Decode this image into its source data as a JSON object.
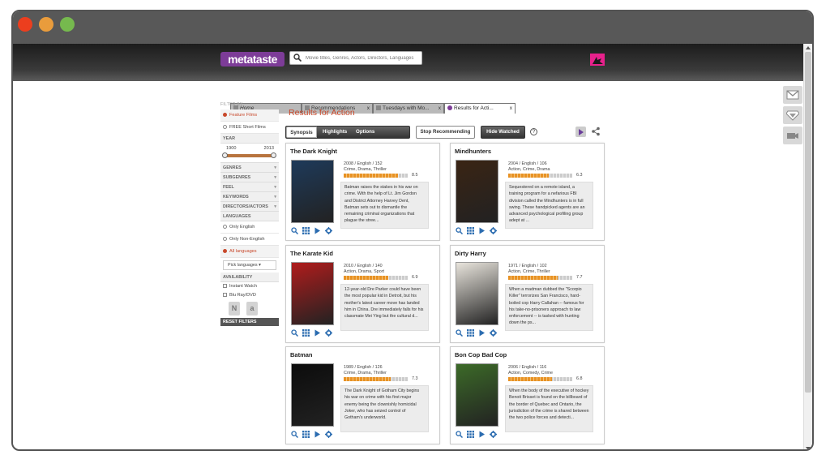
{
  "window_controls": [
    "close",
    "minimize",
    "maximize"
  ],
  "header": {
    "logo": "metataste",
    "search_placeholder": "Movie titles, Genres, Actors, Directors, Languages"
  },
  "tabs": [
    {
      "label": "Home",
      "close": ""
    },
    {
      "label": "Recommendations",
      "close": "x"
    },
    {
      "label": "Tuesdays with Mo...",
      "close": "x"
    },
    {
      "label": "Results for Acti...",
      "close": "x"
    }
  ],
  "sidebar": {
    "filter_by": "FILTER BY",
    "film_types": [
      {
        "label": "Feature Films",
        "selected": true
      },
      {
        "label": "FREE Short Films",
        "selected": false
      }
    ],
    "year": {
      "label": "YEAR",
      "from": "1900",
      "to": "2013"
    },
    "sections": [
      "GENRES",
      "SUBGENRES",
      "FEEL",
      "KEYWORDS",
      "DIRECTORS/ACTORS"
    ],
    "languages": {
      "label": "LANGUAGES",
      "options": [
        {
          "label": "Only English",
          "selected": false
        },
        {
          "label": "Only Non-English",
          "selected": false
        },
        {
          "label": "All languages",
          "selected": true
        }
      ],
      "pick": "Pick languages"
    },
    "availability": {
      "label": "AVAILABILITY",
      "options": [
        "Instant Watch",
        "Blu Ray/DVD"
      ],
      "logos": [
        "N",
        "a"
      ]
    },
    "reset": "RESET FILTERS"
  },
  "main": {
    "title": "Results for Action",
    "segments": [
      "Synopsis",
      "Highlights",
      "Options"
    ],
    "stop_recommending": "Stop Recommending",
    "hide_watched": "Hide Watched",
    "help": "?"
  },
  "movies": [
    {
      "title": "The Dark Knight",
      "meta": "2008 / English / 152",
      "genres": "Crime, Drama, Thriller",
      "rating": "8.5",
      "rating_value": 8.5,
      "synopsis": "Batman raises the stakes in his war on crime. With the help of Lt. Jim Gordon and District Attorney Harvey Dent, Batman sets out to dismantle the remaining criminal organizations that plague the stree...",
      "poster_color": "#1e3a5a"
    },
    {
      "title": "Mindhunters",
      "meta": "2004 / English / 106",
      "genres": "Action, Crime, Drama",
      "rating": "6.3",
      "rating_value": 6.3,
      "synopsis": "Sequestered on a remote island, a training program for a nefarious FBI division called the Mindhunters is in full swing. These handpicked agents are an advanced psychological profiling group adept at ...",
      "poster_color": "#3a2414"
    },
    {
      "title": "The Karate Kid",
      "meta": "2010 / English / 140",
      "genres": "Action, Drama, Sport",
      "rating": "6.9",
      "rating_value": 6.9,
      "synopsis": "12-year-old Dre Parker could have been the most popular kid in Detroit, but his mother's latest career move has landed him in China. Dre immediately falls for his classmate Mei Ying but the cultural d...",
      "poster_color": "#b01c1c"
    },
    {
      "title": "Dirty Harry",
      "meta": "1971 / English / 102",
      "genres": "Action, Crime, Thriller",
      "rating": "7.7",
      "rating_value": 7.7,
      "synopsis": "When a madman dubbed the \"Scorpio Killer\" terrorizes San Francisco, hard-boiled cop Harry Callahan -- famous for his take-no-prisoners approach to law enforcement -- is tasked with hunting down the ps...",
      "poster_color": "#e8e4dc"
    },
    {
      "title": "Batman",
      "meta": "1989 / English / 126",
      "genres": "Crime, Drama, Thriller",
      "rating": "7.3",
      "rating_value": 7.3,
      "synopsis": "The Dark Knight of Gotham City begins his war on crime with his first major enemy being the clownishly homicidal Joker, who has seized control of Gotham's underworld.",
      "poster_color": "#0c0c0c"
    },
    {
      "title": "Bon Cop Bad Cop",
      "meta": "2006 / English / 116",
      "genres": "Action, Comedy, Crime",
      "rating": "6.8",
      "rating_value": 6.8,
      "synopsis": "When the body of the executive of hockey Benoit Brisset is found on the billboard of the border of Quebec and Ontario, the jurisdiction of the crime is shared between the two police forces and detecti...",
      "poster_color": "#3c6a28"
    }
  ],
  "colors": {
    "accent": "#c8482b",
    "brand": "#7d3c98",
    "rating": "#e89224"
  }
}
